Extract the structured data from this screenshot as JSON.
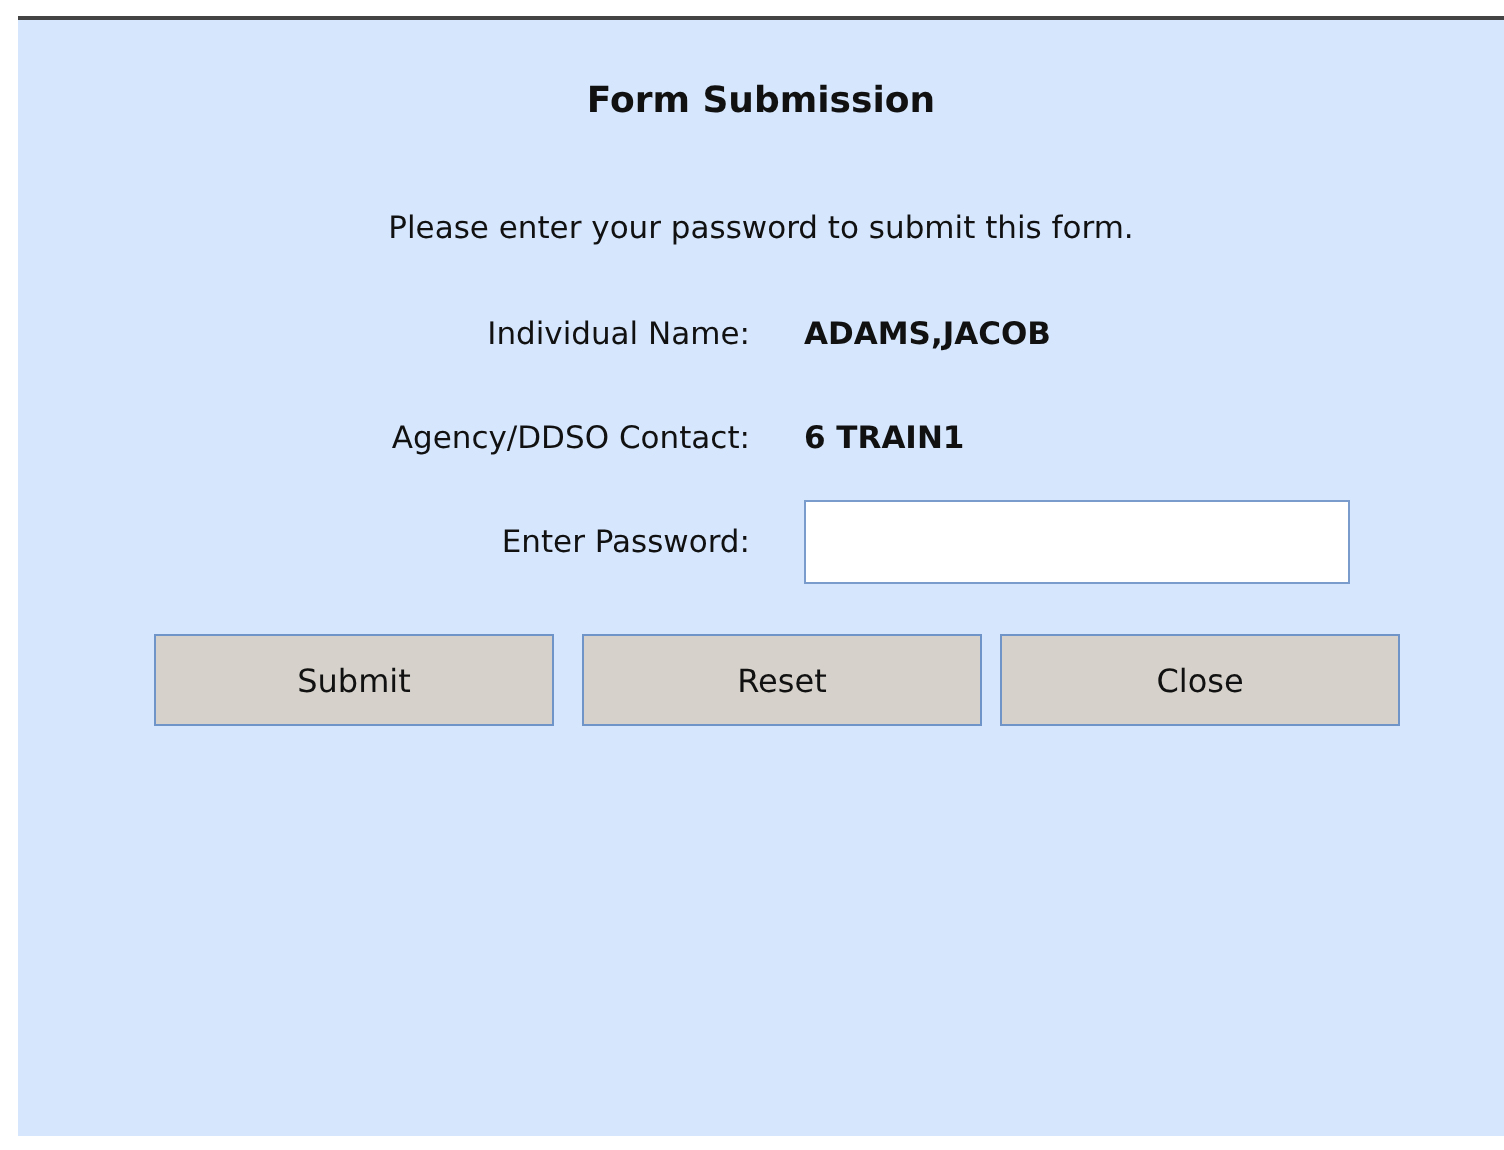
{
  "dialog": {
    "title": "Form Submission",
    "instruction": "Please enter your password to submit this form.",
    "fields": [
      {
        "kind": "text",
        "label": "Individual Name:",
        "value": "ADAMS,JACOB"
      },
      {
        "kind": "text",
        "label": "Agency/DDSO Contact:",
        "value": "6 TRAIN1"
      },
      {
        "kind": "password",
        "label": "Enter Password:"
      }
    ],
    "buttons": [
      "Submit",
      "Reset",
      "Close"
    ]
  }
}
